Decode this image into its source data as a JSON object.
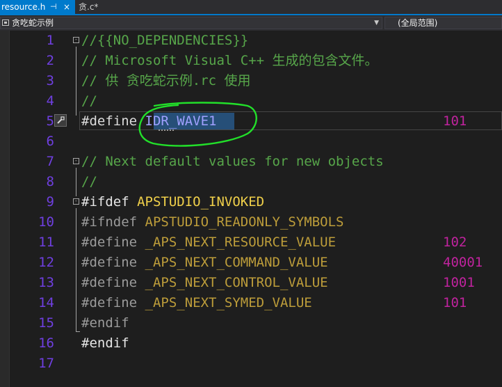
{
  "tabs": [
    {
      "label": "resource.h",
      "active": true,
      "pin": "⊣",
      "close": "×"
    },
    {
      "label": "贪.c*",
      "active": false
    }
  ],
  "nav": {
    "project_scope": "贪吃蛇示例",
    "global_scope": "(全局范围)"
  },
  "colors": {
    "accent": "#007acc",
    "comment": "#57a64a",
    "preprocessor": "#9b9b9b",
    "macro": "#bd9d3a",
    "number": "#c0239e",
    "line_number": "#6f3fe0",
    "annotation": "#22e02a"
  },
  "lines": [
    {
      "n": "1",
      "text": "//{{NO_DEPENDENCIES}}"
    },
    {
      "n": "2",
      "text": "// Microsoft Visual C++ 生成的包含文件。"
    },
    {
      "n": "3",
      "text": "// 供 贪吃蛇示例.rc 使用"
    },
    {
      "n": "4",
      "text": "//"
    },
    {
      "n": "5",
      "directive": "#define ",
      "name": "IDR_WAVE1",
      "value": "101"
    },
    {
      "n": "6",
      "text": ""
    },
    {
      "n": "7",
      "text": "// Next default values for new objects"
    },
    {
      "n": "8",
      "text": "//"
    },
    {
      "n": "9",
      "directive": "#ifdef ",
      "name": "APSTUDIO_INVOKED"
    },
    {
      "n": "10",
      "directive": "#ifndef ",
      "name": "APSTUDIO_READONLY_SYMBOLS"
    },
    {
      "n": "11",
      "directive": "#define ",
      "name": "_APS_NEXT_RESOURCE_VALUE",
      "value": "102"
    },
    {
      "n": "12",
      "directive": "#define ",
      "name": "_APS_NEXT_COMMAND_VALUE",
      "value": "40001"
    },
    {
      "n": "13",
      "directive": "#define ",
      "name": "_APS_NEXT_CONTROL_VALUE",
      "value": "1001"
    },
    {
      "n": "14",
      "directive": "#define ",
      "name": "_APS_NEXT_SYMED_VALUE",
      "value": "101"
    },
    {
      "n": "15",
      "directive": "#endif"
    },
    {
      "n": "16",
      "directive": "#endif"
    },
    {
      "n": "17",
      "text": ""
    }
  ],
  "icons": {
    "lightbulb": "screwdriver-icon",
    "pin": "pin-icon",
    "close": "close-icon"
  }
}
